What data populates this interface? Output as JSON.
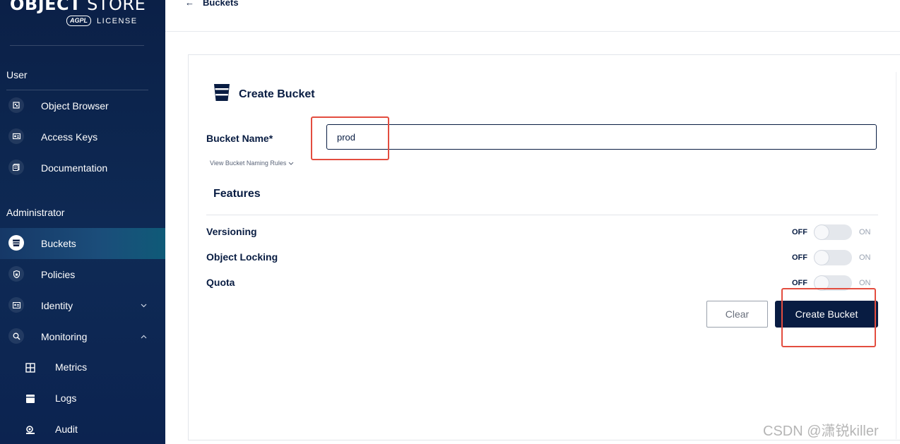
{
  "sidebar": {
    "logo": {
      "title_bold": "OBJECT",
      "title_thin": " STORE",
      "badge": "AGPL",
      "license": "LICENSE"
    },
    "user_section": "User",
    "user_items": [
      {
        "label": "Object Browser",
        "icon": "object-browser-icon"
      },
      {
        "label": "Access Keys",
        "icon": "access-keys-icon"
      },
      {
        "label": "Documentation",
        "icon": "documentation-icon"
      }
    ],
    "admin_section": "Administrator",
    "admin_items": [
      {
        "label": "Buckets",
        "icon": "bucket-icon",
        "active": true
      },
      {
        "label": "Policies",
        "icon": "shield-icon"
      },
      {
        "label": "Identity",
        "icon": "identity-icon",
        "chevron": "chevron-down-icon"
      },
      {
        "label": "Monitoring",
        "icon": "monitoring-icon",
        "chevron": "chevron-up-icon"
      }
    ],
    "monitoring_items": [
      {
        "label": "Metrics",
        "icon": "metrics-icon"
      },
      {
        "label": "Logs",
        "icon": "logs-icon"
      },
      {
        "label": "Audit",
        "icon": "audit-icon"
      }
    ]
  },
  "header": {
    "back_arrow": "←",
    "back_label": "Buckets"
  },
  "form": {
    "title": "Create Bucket",
    "bucket_name_label": "Bucket Name*",
    "bucket_name_value": "prod",
    "naming_rules_link": "View Bucket Naming Rules",
    "features_heading": "Features",
    "features": [
      {
        "label": "Versioning",
        "off": "OFF",
        "on": "ON",
        "enabled": false
      },
      {
        "label": "Object Locking",
        "off": "OFF",
        "on": "ON",
        "enabled": false
      },
      {
        "label": "Quota",
        "off": "OFF",
        "on": "ON",
        "enabled": false
      }
    ],
    "clear_button": "Clear",
    "create_button": "Create Bucket"
  },
  "colors": {
    "sidebar": "#0b2047",
    "primary": "#081c42",
    "highlight": "#e34d3f"
  },
  "watermark": "CSDN @潇锐killer"
}
